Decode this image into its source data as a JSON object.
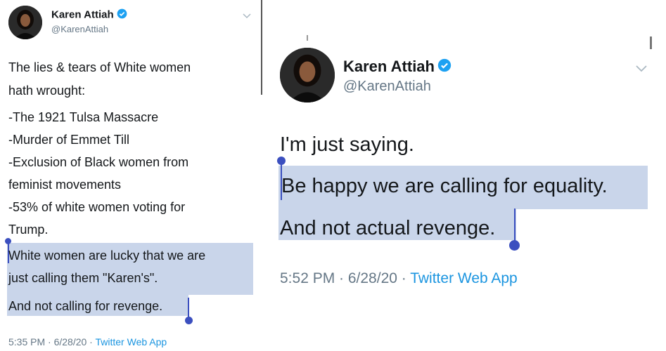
{
  "left_tweet": {
    "author_name": "Karen Attiah",
    "author_handle": "@KarenAttiah",
    "lines": [
      "The lies & tears of White women",
      "hath wrought:",
      "-The 1921 Tulsa Massacre",
      "-Murder of Emmet Till",
      "-Exclusion of Black women from",
      "feminist movements",
      "-53% of white women voting for",
      "Trump."
    ],
    "selected_lines": [
      "White women are lucky that we are",
      "just calling them \"Karen's\".",
      "And not calling for revenge."
    ],
    "time": "5:35 PM · 6/28/20 · ",
    "app": "Twitter Web App"
  },
  "right_tweet": {
    "author_name": "Karen Attiah",
    "author_handle": "@KarenAttiah",
    "line1": "I'm just saying.",
    "selected_lines": [
      "Be happy we are calling for equality.",
      "And not actual revenge."
    ],
    "time": "5:52 PM · 6/28/20 · ",
    "app": "Twitter Web App"
  },
  "colors": {
    "verified": "#1da1f2",
    "selection": "#c9d5ea",
    "handle": "#3b4fbf",
    "link": "#1b95e0"
  },
  "icons": [
    "verified-badge-icon",
    "chevron-down-icon"
  ]
}
